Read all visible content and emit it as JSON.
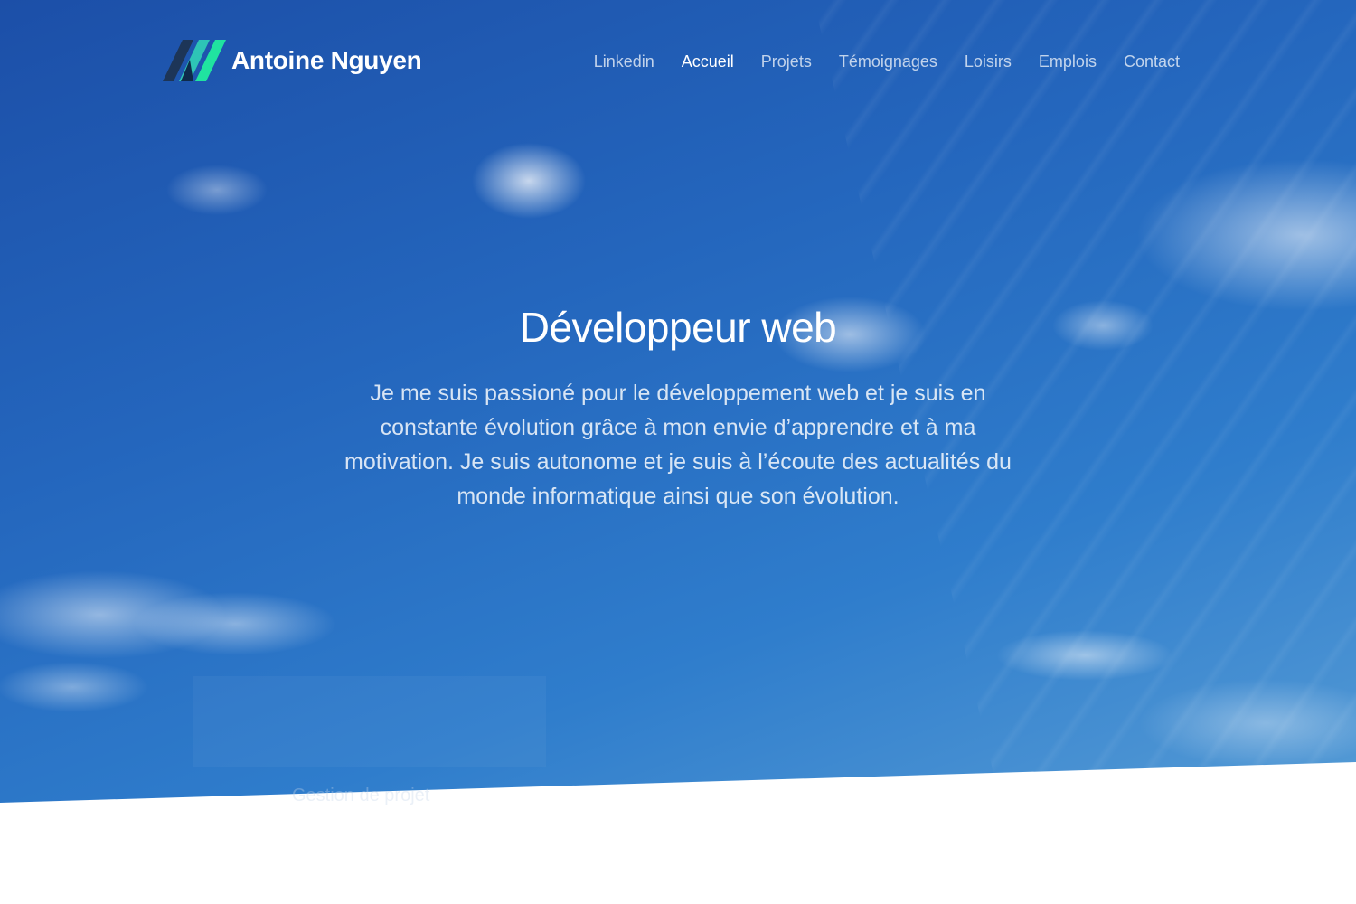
{
  "header": {
    "brand_name": "Antoine Nguyen",
    "nav": [
      {
        "label": "Linkedin",
        "active": false
      },
      {
        "label": "Accueil",
        "active": true
      },
      {
        "label": "Projets",
        "active": false
      },
      {
        "label": "Témoignages",
        "active": false
      },
      {
        "label": "Loisirs",
        "active": false
      },
      {
        "label": "Emplois",
        "active": false
      },
      {
        "label": "Contact",
        "active": false
      }
    ]
  },
  "hero": {
    "title": "Développeur web",
    "description": "Je me suis passioné pour le développement web et je suis en constante évolution grâce à mon envie d’apprendre et à ma motivation. Je suis autonome et je suis à l’écoute des actualités du monde informatique ainsi que son évolution."
  },
  "section_preview": {
    "label": "Gestion de projet"
  },
  "colors": {
    "logo_dark": "#1d3557",
    "logo_teal": "#2ec4b6",
    "logo_green": "#20e3a0",
    "sky_top": "#1c4fa8",
    "sky_bottom": "#5fa3d8"
  },
  "icons": {
    "logo": "brand-logo-icon"
  }
}
